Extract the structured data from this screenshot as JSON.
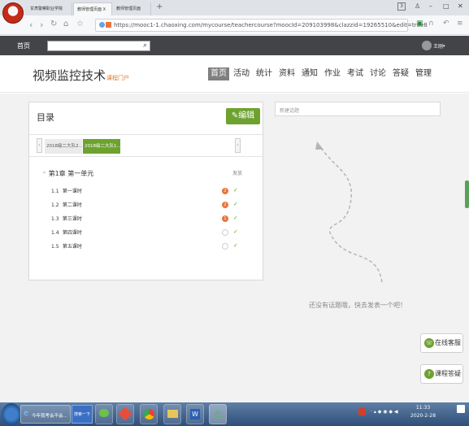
{
  "browser": {
    "tabs": [
      "甘肃警察职业学院",
      "教师管理页面",
      "教师管理页面"
    ],
    "close_glyph": "X",
    "new_tab_glyph": "+",
    "url": "https://mooc1-1.chaoxing.com/mycourse/teachercourse?moocId=209103998&clazzid=19265510&edit=true8",
    "page_number": "3"
  },
  "site": {
    "home_label": "首页",
    "user_name": "王刚"
  },
  "course": {
    "title": "视频监控技术",
    "portal_label": "课程门户",
    "nav": [
      "首页",
      "活动",
      "统计",
      "资料",
      "通知",
      "作业",
      "考试",
      "讨论",
      "答疑",
      "管理"
    ]
  },
  "catalog": {
    "title": "目录",
    "edit_label": "编辑",
    "class_tabs": [
      "2018级二大队2...",
      "2018级二大队1..."
    ],
    "chapter_label": "第1章 第一单元",
    "release_label": "发放",
    "lessons": [
      {
        "num": "1.1",
        "name": "第一课时",
        "badge": "2"
      },
      {
        "num": "1.2",
        "name": "第二课时",
        "badge": "2"
      },
      {
        "num": "1.3",
        "name": "第三课时",
        "badge": "1"
      },
      {
        "num": "1.4",
        "name": "第四课时",
        "badge": ""
      },
      {
        "num": "1.5",
        "name": "第五课时",
        "badge": ""
      }
    ]
  },
  "discussion": {
    "new_topic_placeholder": "新建话题",
    "empty_message": "还没有话题哦，快去发表一个吧！"
  },
  "side_buttons": {
    "online_service": "在线客服",
    "course_qa": "课程答疑"
  },
  "taskbar": {
    "task1": "今年我考会不会...",
    "search_label": "搜索一下",
    "time": "11:33",
    "date": "2020-2-28"
  },
  "colors": {
    "accent_green": "#6da22f",
    "badge_orange": "#e8743b",
    "site_bar": "#424448"
  }
}
